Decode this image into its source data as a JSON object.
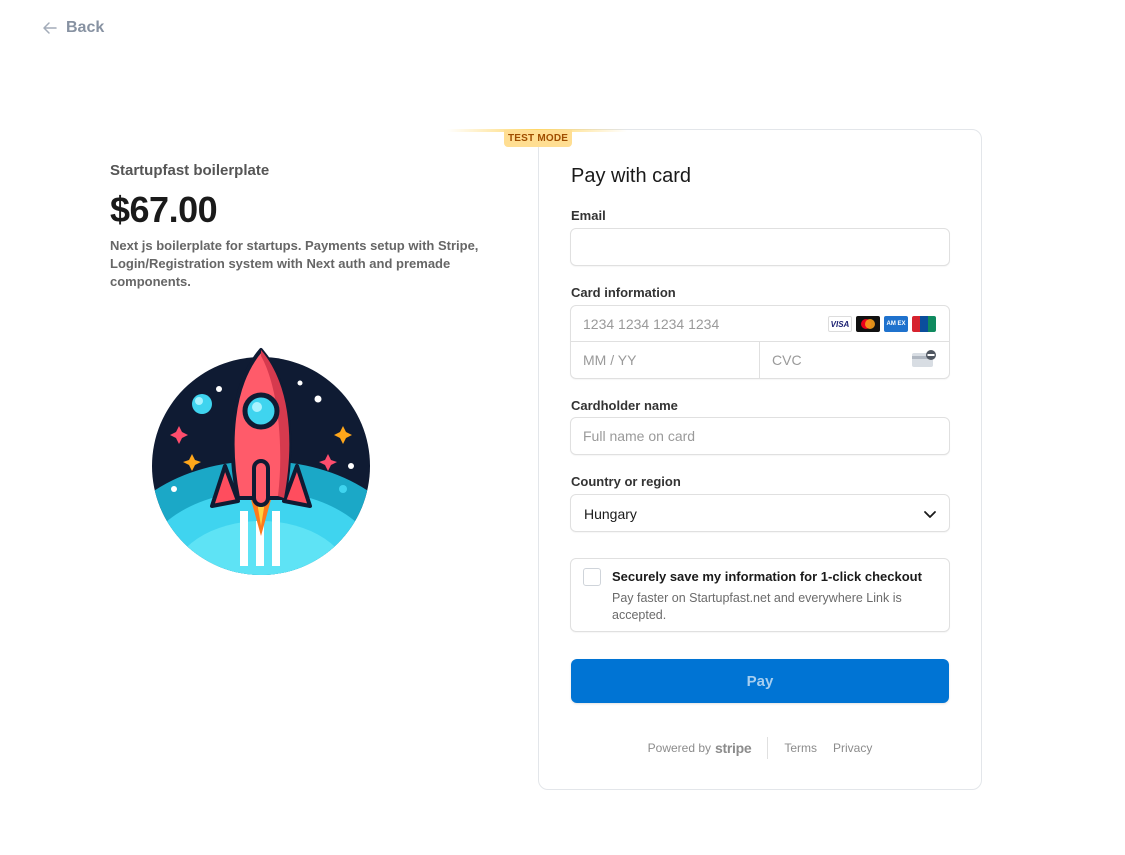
{
  "nav": {
    "back_label": "Back"
  },
  "product": {
    "name": "Startupfast boilerplate",
    "price": "$67.00",
    "description": "Next js boilerplate for startups. Payments setup with Stripe, Login/Registration system with Next auth and premade components."
  },
  "checkout": {
    "test_badge": "TEST MODE",
    "title": "Pay with card",
    "email": {
      "label": "Email",
      "value": "",
      "placeholder": ""
    },
    "card_info": {
      "label": "Card information",
      "number_placeholder": "1234 1234 1234 1234",
      "expiry_placeholder": "MM / YY",
      "cvc_placeholder": "CVC",
      "brands": [
        "VISA",
        "mastercard",
        "amex",
        "unionpay"
      ],
      "visa_label": "VISA",
      "amex_label": "AM EX"
    },
    "cardholder": {
      "label": "Cardholder name",
      "placeholder": "Full name on card"
    },
    "country": {
      "label": "Country or region",
      "value": "Hungary"
    },
    "save_info": {
      "checked": false,
      "title": "Securely save my information for 1-click checkout",
      "description": "Pay faster on Startupfast.net and everywhere Link is accepted."
    },
    "pay_label": "Pay"
  },
  "footer": {
    "powered_by": "Powered by",
    "stripe": "stripe",
    "terms": "Terms",
    "privacy": "Privacy"
  },
  "colors": {
    "accent": "#0074d4",
    "test_badge_bg": "#ffde92",
    "test_badge_text": "#a04e00"
  }
}
